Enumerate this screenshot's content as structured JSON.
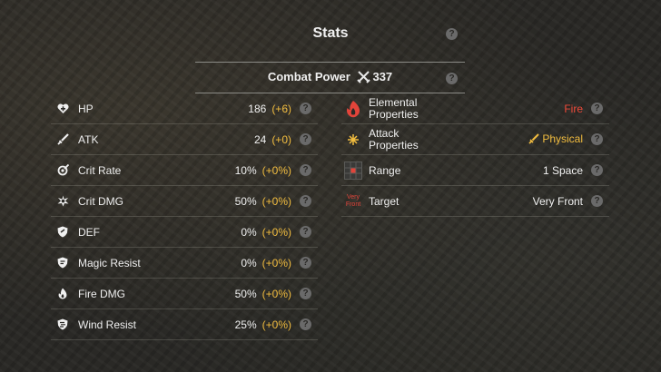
{
  "header": {
    "title": "Stats"
  },
  "combat_power": {
    "label": "Combat Power",
    "value": "337"
  },
  "left_stats": [
    {
      "label": "HP",
      "value": "186",
      "bonus": "(+6)",
      "icon": "heart-icon"
    },
    {
      "label": "ATK",
      "value": "24",
      "bonus": "(+0)",
      "icon": "sword-icon"
    },
    {
      "label": "Crit Rate",
      "value": "10%",
      "bonus": "(+0%)",
      "icon": "crit-rate-icon"
    },
    {
      "label": "Crit DMG",
      "value": "50%",
      "bonus": "(+0%)",
      "icon": "crit-dmg-icon"
    },
    {
      "label": "DEF",
      "value": "0%",
      "bonus": "(+0%)",
      "icon": "shield-icon"
    },
    {
      "label": "Magic Resist",
      "value": "0%",
      "bonus": "(+0%)",
      "icon": "magic-shield-icon"
    },
    {
      "label": "Fire DMG",
      "value": "50%",
      "bonus": "(+0%)",
      "icon": "fire-dmg-icon"
    },
    {
      "label": "Wind Resist",
      "value": "25%",
      "bonus": "(+0%)",
      "icon": "wind-shield-icon"
    }
  ],
  "right_stats": [
    {
      "label_line1": "Elemental",
      "label_line2": "Properties",
      "value": "Fire",
      "icon": "fire-element-icon"
    },
    {
      "label_line1": "Attack",
      "label_line2": "Properties",
      "value": "Physical",
      "icon": "attack-property-icon"
    },
    {
      "label": "Range",
      "value": "1 Space",
      "icon": "range-grid-icon"
    },
    {
      "label": "Target",
      "value": "Very Front",
      "icon": "very-front-icon",
      "icon_text_1": "Very",
      "icon_text_2": "Front"
    }
  ],
  "help_glyph": "?",
  "colors": {
    "bonus": "#f2bd3f",
    "fire": "#ef4a3a",
    "help_circle": "#6a6a6a"
  }
}
